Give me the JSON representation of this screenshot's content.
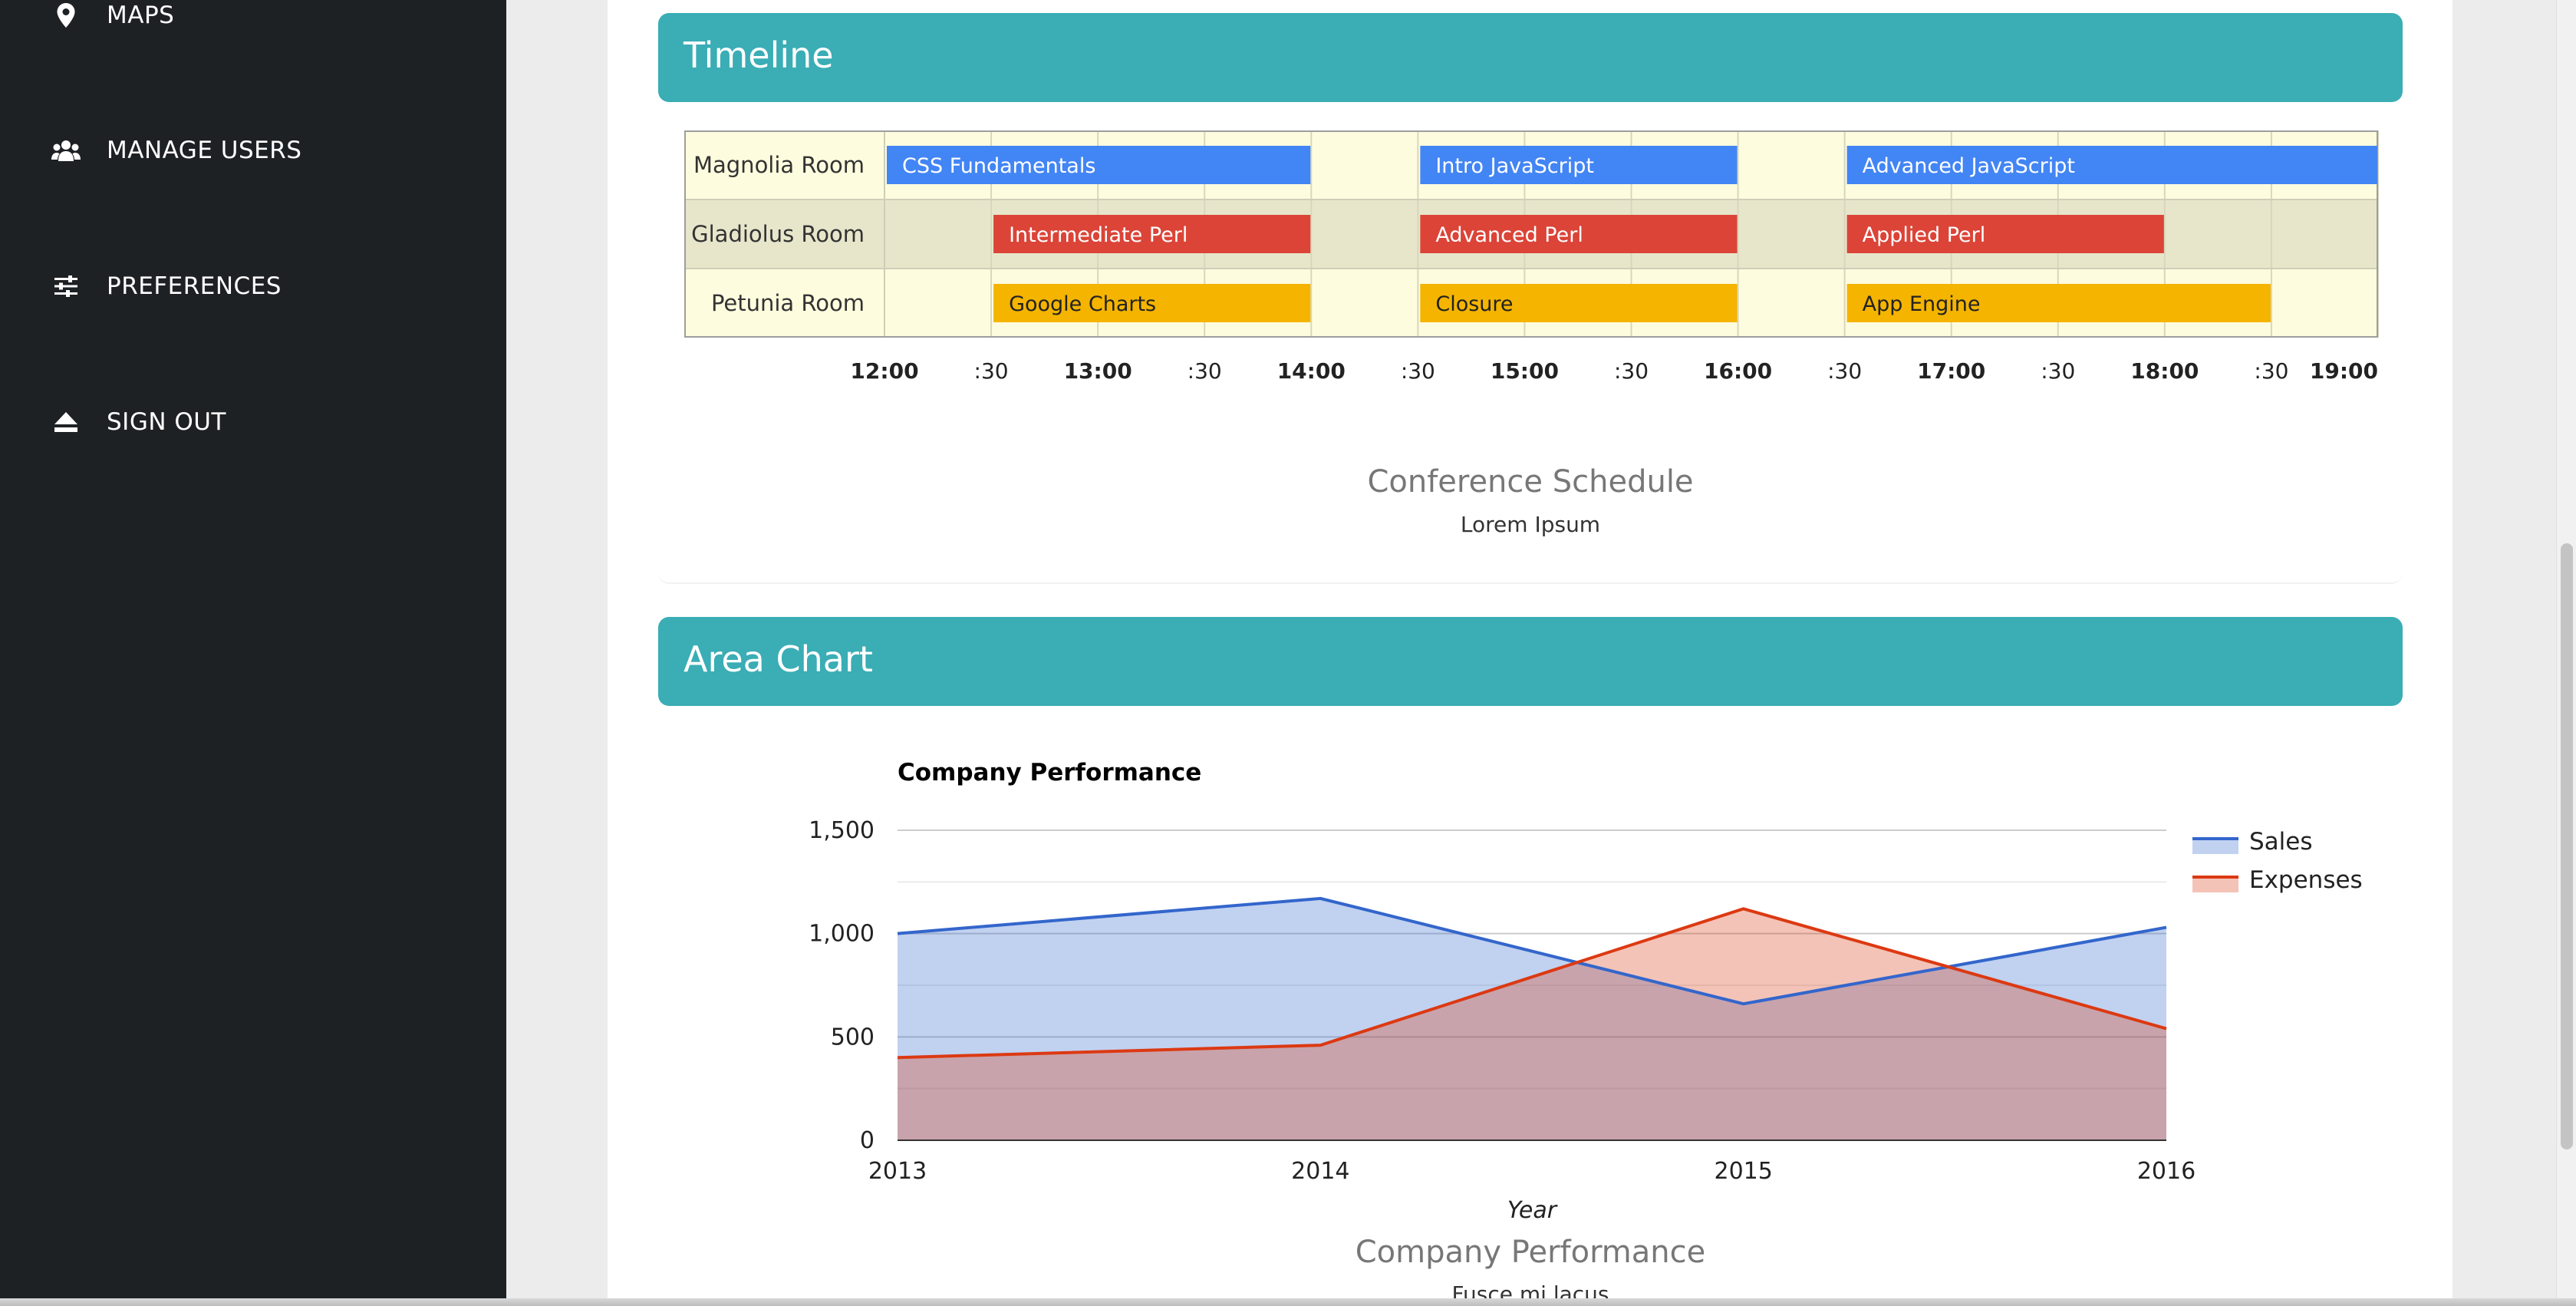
{
  "sidebar": {
    "items": [
      {
        "label": "MAPS",
        "icon": "map-pin-icon"
      },
      {
        "label": "MANAGE USERS",
        "icon": "users-icon"
      },
      {
        "label": "PREFERENCES",
        "icon": "sliders-icon"
      },
      {
        "label": "SIGN OUT",
        "icon": "eject-icon"
      }
    ]
  },
  "timeline_card": {
    "title": "Timeline",
    "caption_title": "Conference Schedule",
    "caption_subtitle": "Lorem Ipsum",
    "rows": [
      {
        "room": "Magnolia Room",
        "bar_color": "#4285f4",
        "row_fill": "#fefcde",
        "events": [
          {
            "name": "CSS Fundamentals",
            "start": "12:00",
            "end": "14:00"
          },
          {
            "name": "Intro JavaScript",
            "start": "14:30",
            "end": "16:00"
          },
          {
            "name": "Advanced JavaScript",
            "start": "16:30",
            "end": "19:00"
          }
        ]
      },
      {
        "room": "Gladiolus Room",
        "bar_color": "#db4437",
        "row_fill": "#e7e6cb",
        "events": [
          {
            "name": "Intermediate Perl",
            "start": "12:30",
            "end": "14:00"
          },
          {
            "name": "Advanced Perl",
            "start": "14:30",
            "end": "16:00"
          },
          {
            "name": "Applied Perl",
            "start": "16:30",
            "end": "18:00"
          }
        ]
      },
      {
        "room": "Petunia Room",
        "bar_color": "#f4b400",
        "row_fill": "#fefcde",
        "events": [
          {
            "name": "Google Charts",
            "start": "12:30",
            "end": "14:00"
          },
          {
            "name": "Closure",
            "start": "14:30",
            "end": "16:00"
          },
          {
            "name": "App Engine",
            "start": "16:30",
            "end": "18:30"
          }
        ]
      }
    ],
    "ticks": [
      "12:00",
      ":30",
      "13:00",
      ":30",
      "14:00",
      ":30",
      "15:00",
      ":30",
      "16:00",
      ":30",
      "17:00",
      ":30",
      "18:00",
      ":30",
      "19:00"
    ]
  },
  "area_card": {
    "title": "Area Chart",
    "caption_title": "Company Performance",
    "caption_subtitle": "Fusce mi lacus"
  },
  "chart_data": {
    "type": "area",
    "title": "Company Performance",
    "xlabel": "Year",
    "ylabel": "",
    "categories": [
      "2013",
      "2014",
      "2015",
      "2016"
    ],
    "series": [
      {
        "name": "Sales",
        "values": [
          1000,
          1170,
          660,
          1030
        ],
        "color": "#3366cc"
      },
      {
        "name": "Expenses",
        "values": [
          400,
          460,
          1120,
          540
        ],
        "color": "#dc3912"
      }
    ],
    "ylim": [
      0,
      1500
    ],
    "yticks": [
      "0",
      "500",
      "1,000",
      "1,500"
    ],
    "grid": true,
    "legend": "right"
  },
  "colors": {
    "sidebar": "#1e2124",
    "accent": "#3aadb5"
  }
}
